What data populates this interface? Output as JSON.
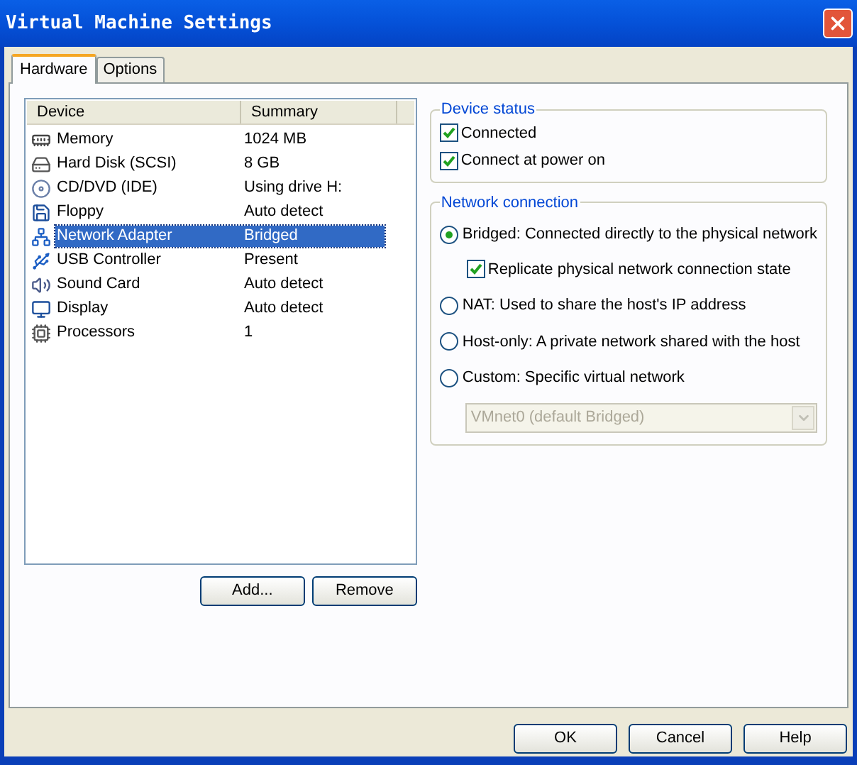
{
  "window": {
    "title": "Virtual Machine Settings"
  },
  "tabs": [
    {
      "label": "Hardware",
      "selected": true
    },
    {
      "label": "Options",
      "selected": false
    }
  ],
  "device_list": {
    "columns": [
      "Device",
      "Summary"
    ],
    "rows": [
      {
        "kind": "memory",
        "device": "Memory",
        "summary": "1024 MB",
        "selected": false
      },
      {
        "kind": "hard-disk",
        "device": "Hard Disk (SCSI)",
        "summary": "8 GB",
        "selected": false
      },
      {
        "kind": "cd",
        "device": "CD/DVD (IDE)",
        "summary": "Using drive H:",
        "selected": false
      },
      {
        "kind": "floppy",
        "device": "Floppy",
        "summary": "Auto detect",
        "selected": false
      },
      {
        "kind": "network",
        "device": "Network Adapter",
        "summary": "Bridged",
        "selected": true
      },
      {
        "kind": "usb",
        "device": "USB Controller",
        "summary": "Present",
        "selected": false
      },
      {
        "kind": "sound",
        "device": "Sound Card",
        "summary": "Auto detect",
        "selected": false
      },
      {
        "kind": "display",
        "device": "Display",
        "summary": "Auto detect",
        "selected": false
      },
      {
        "kind": "processor",
        "device": "Processors",
        "summary": "1",
        "selected": false
      }
    ]
  },
  "list_buttons": [
    "Add...",
    "Remove"
  ],
  "device_status": {
    "title": "Device status",
    "options": [
      {
        "label": "Connected",
        "checked": true
      },
      {
        "label": "Connect at power on",
        "checked": true
      }
    ]
  },
  "network_connection": {
    "title": "Network connection",
    "options": [
      {
        "label": "Bridged: Connected directly to the physical network",
        "selected": true,
        "sub_option": {
          "label": "Replicate physical network connection state",
          "checked": true
        }
      },
      {
        "label": "NAT: Used to share the host's IP address",
        "selected": false
      },
      {
        "label": "Host-only: A private network shared with the host",
        "selected": false
      },
      {
        "label": "Custom: Specific virtual network",
        "selected": false
      }
    ],
    "dropdown": {
      "value": "VMnet0 (default Bridged)",
      "disabled": true
    }
  },
  "dialog_buttons": [
    "OK",
    "Cancel",
    "Help"
  ]
}
